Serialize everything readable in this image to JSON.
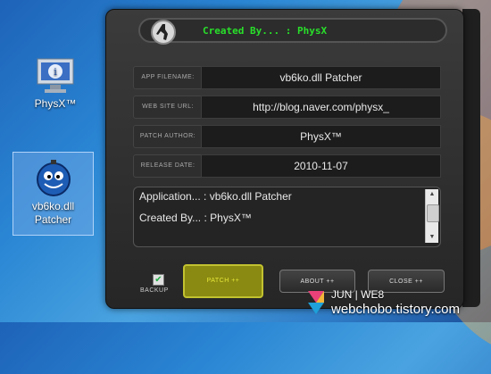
{
  "desktop": {
    "icons": [
      {
        "label": "PhysX™"
      },
      {
        "label_line1": "vb6ko.dll",
        "label_line2": "Patcher"
      }
    ]
  },
  "app": {
    "header_title": "Created By... : PhysX",
    "fields": [
      {
        "label": "APP FILENAME:",
        "value": "vb6ko.dll Patcher"
      },
      {
        "label": "WEB SITE URL:",
        "value": "http://blog.naver.com/physx_"
      },
      {
        "label": "PATCH AUTHOR:",
        "value": "PhysX™"
      },
      {
        "label": "RELEASE DATE:",
        "value": "2010-11-07"
      }
    ],
    "info_lines": [
      "Application... : vb6ko.dll Patcher",
      "Created By... : PhysX™"
    ],
    "backup_label": "BACKUP",
    "backup_checked": true,
    "buttons": {
      "patch": "PATCH ++",
      "about": "ABOUT ++",
      "close": "CLOSE ++"
    }
  },
  "watermark": {
    "line1": "JUN | WE8",
    "line2": "webchobo.tistory.com"
  },
  "colors": {
    "header_text": "#29e02a",
    "patch_button": "#8a8a12"
  }
}
